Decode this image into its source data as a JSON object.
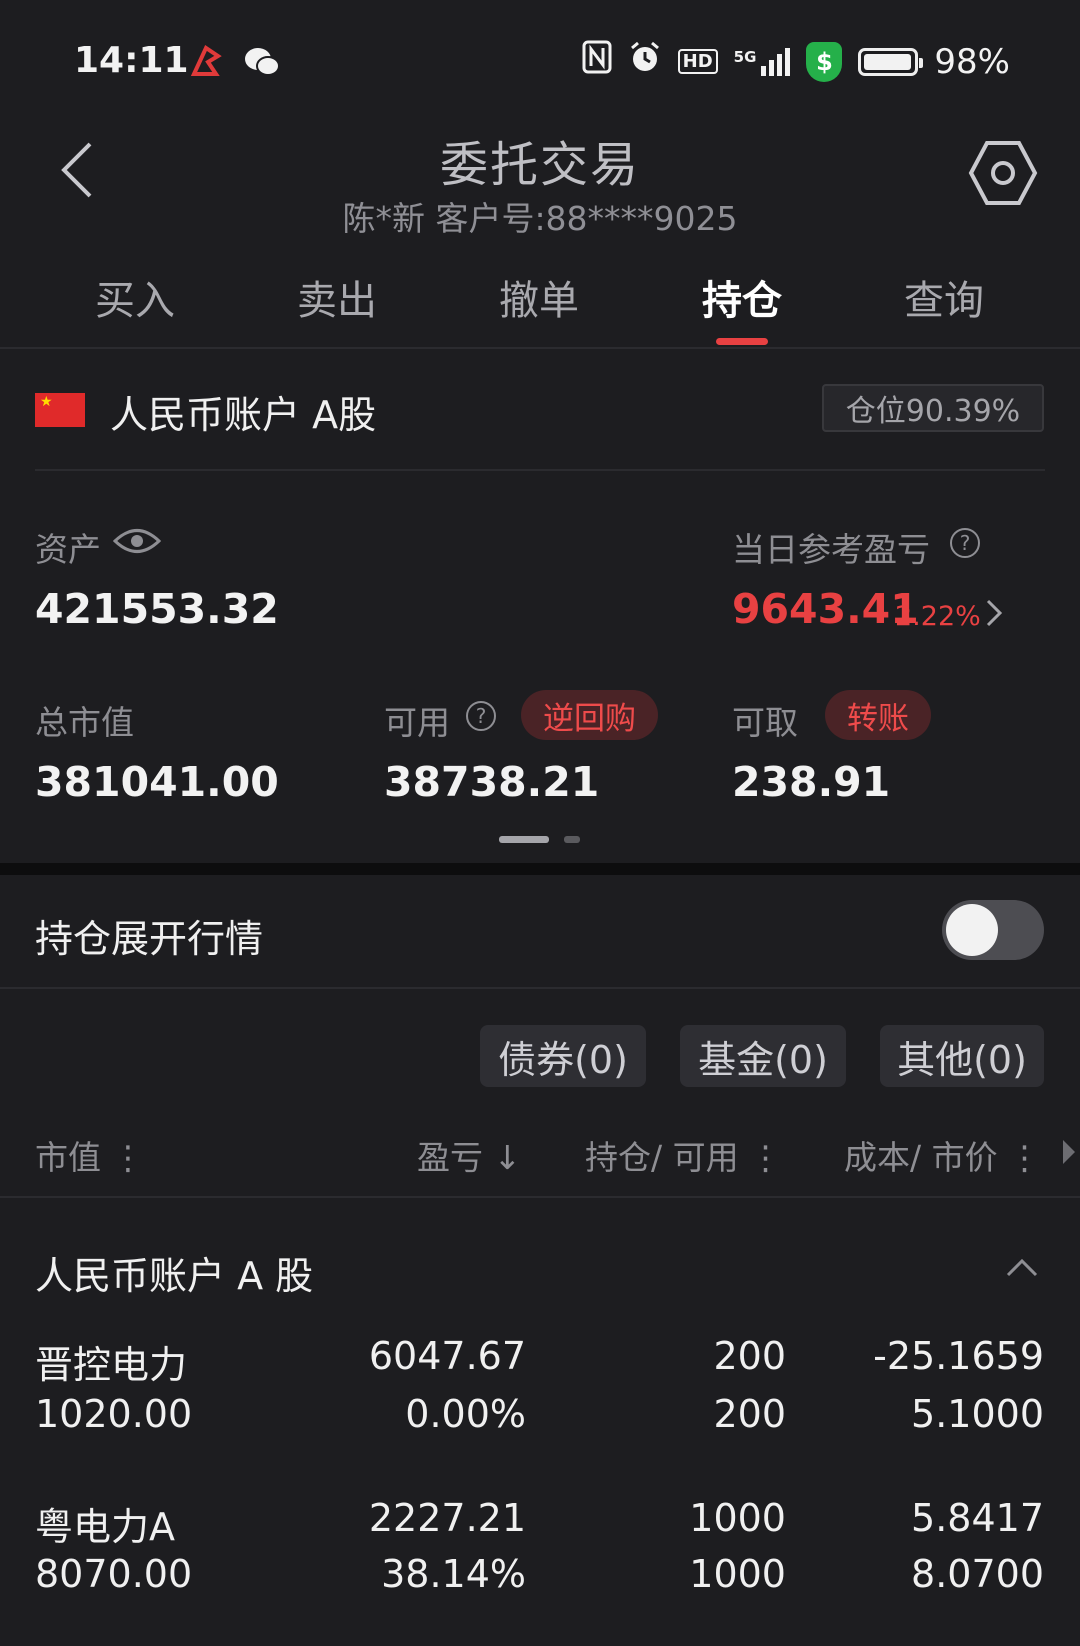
{
  "status_bar": {
    "time": "14:11",
    "battery_percent": "98%",
    "battery_level": 0.98,
    "icons": [
      "app-icon",
      "wechat-icon",
      "nfc-icon",
      "alarm-icon",
      "hd-icon",
      "5g-signal-icon",
      "shield-icon",
      "battery-icon"
    ],
    "network": "5G",
    "hd": "HD",
    "shield_symbol": "$"
  },
  "header": {
    "title": "委托交易",
    "subtitle": "陈*新  客户号:88****9025"
  },
  "tabs": [
    {
      "label": "买入"
    },
    {
      "label": "卖出"
    },
    {
      "label": "撤单"
    },
    {
      "label": "持仓"
    },
    {
      "label": "查询"
    }
  ],
  "account": {
    "name": "人民币账户 A股",
    "position_ratio": "仓位90.39%"
  },
  "summary": {
    "assets_label": "资产",
    "assets_value": "421553.32",
    "daily_pnl_label": "当日参考盈亏",
    "daily_pnl_value": "9643.41",
    "daily_pnl_pct": "2.22%",
    "market_value_label": "总市值",
    "market_value": "381041.00",
    "available_label": "可用",
    "available_value": "38738.21",
    "reverse_repo_label": "逆回购",
    "withdrawable_label": "可取",
    "withdrawable_value": "238.91",
    "transfer_label": "转账"
  },
  "expand": {
    "label": "持仓展开行情",
    "enabled": false
  },
  "filters": [
    {
      "label": "债券(0)"
    },
    {
      "label": "基金(0)"
    },
    {
      "label": "其他(0)"
    }
  ],
  "columns": {
    "market_value": "市值",
    "pnl": "盈亏",
    "holding": "持仓/ 可用",
    "cost_price": "成本/ 市价"
  },
  "group": {
    "label": "人民币账户 A 股"
  },
  "holdings": [
    {
      "name": "晋控电力",
      "market_value": "1020.00",
      "pnl": "6047.67",
      "pnl_pct": "0.00%",
      "holding": "200",
      "available": "200",
      "cost": "-25.1659",
      "price": "5.1000"
    },
    {
      "name": "粤电力A",
      "market_value": "8070.00",
      "pnl": "2227.21",
      "pnl_pct": "38.14%",
      "holding": "1000",
      "available": "1000",
      "cost": "5.8417",
      "price": "8.0700"
    }
  ],
  "colors": {
    "accent": "#e84142",
    "background": "#1d1d20",
    "text": "#f2f2f2",
    "muted": "#8e8e93"
  }
}
